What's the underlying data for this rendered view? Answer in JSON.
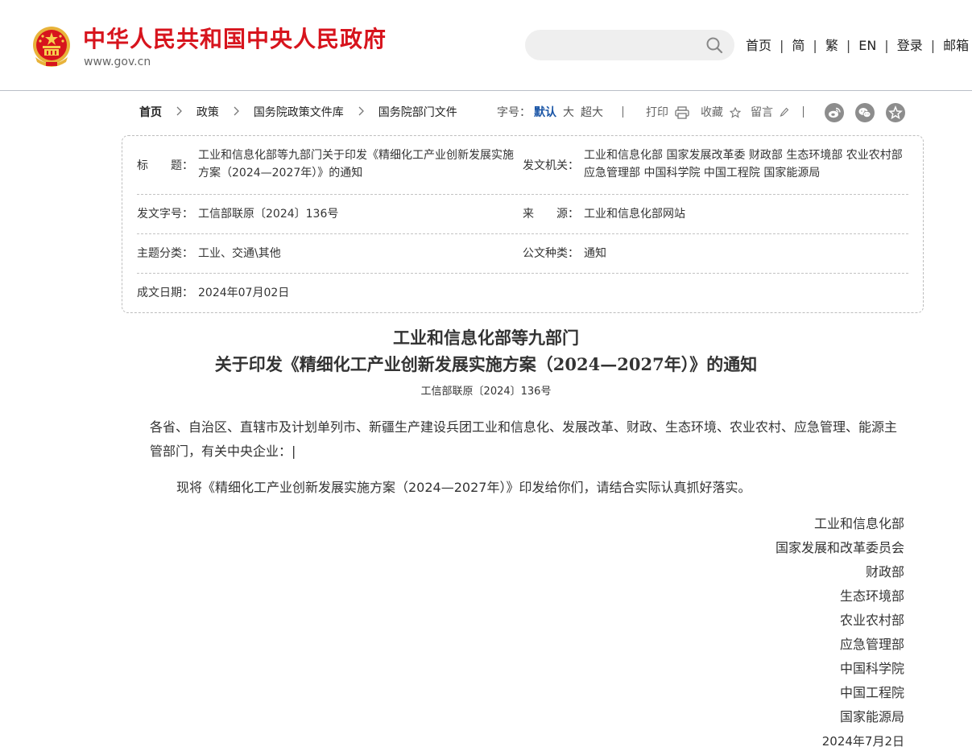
{
  "header": {
    "site_title": "中华人民共和国中央人民政府",
    "site_domain": "www.gov.cn",
    "search": {
      "value": "",
      "placeholder": ""
    },
    "nav": [
      "首页",
      "简",
      "繁",
      "EN",
      "登录",
      "邮箱"
    ],
    "nav_separator": "|",
    "brand_color": "#d7141d"
  },
  "toolbar": {
    "breadcrumb": [
      "首页",
      "政策",
      "国务院政策文件库",
      "国务院部门文件"
    ],
    "fontsize_label": "字号：",
    "fontsize_options": [
      "默认",
      "大",
      "超大"
    ],
    "fontsize_selected": "默认",
    "print_label": "打印",
    "favorite_label": "收藏",
    "comment_label": "留言",
    "share_icons": [
      "weibo-icon",
      "wechat-icon",
      "star-icon"
    ]
  },
  "meta": {
    "title_label": "标　　题：",
    "title_value": "工业和信息化部等九部门关于印发《精细化工产业创新发展实施方案（2024—2027年）》的通知",
    "issuer_label": "发文机关：",
    "issuer_value": "工业和信息化部 国家发展改革委 财政部 生态环境部 农业农村部 应急管理部 中国科学院 中国工程院 国家能源局",
    "docnum_label": "发文字号：",
    "docnum_value": "工信部联原〔2024〕136号",
    "source_label": "来　　源：",
    "source_value": "工业和信息化部网站",
    "topic_label": "主题分类：",
    "topic_value": "工业、交通\\其他",
    "type_label": "公文种类：",
    "type_value": "通知",
    "date_label": "成文日期：",
    "date_value": "2024年07月02日"
  },
  "article": {
    "title_line1": "工业和信息化部等九部门",
    "title_line2": "关于印发《精细化工产业创新发展实施方案（2024—2027年）》的通知",
    "doc_number": "工信部联原〔2024〕136号",
    "addressee": "各省、自治区、直辖市及计划单列市、新疆生产建设兵团工业和信息化、发展改革、财政、生态环境、农业农村、应急管理、能源主管部门，有关中央企业：",
    "cursor": "|",
    "body": "现将《精细化工产业创新发展实施方案（2024—2027年）》印发给你们，请结合实际认真抓好落实。",
    "signatories": [
      "工业和信息化部",
      "国家发展和改革委员会",
      "财政部",
      "生态环境部",
      "农业农村部",
      "应急管理部",
      "中国科学院",
      "中国工程院",
      "国家能源局"
    ],
    "date": "2024年7月2日"
  }
}
